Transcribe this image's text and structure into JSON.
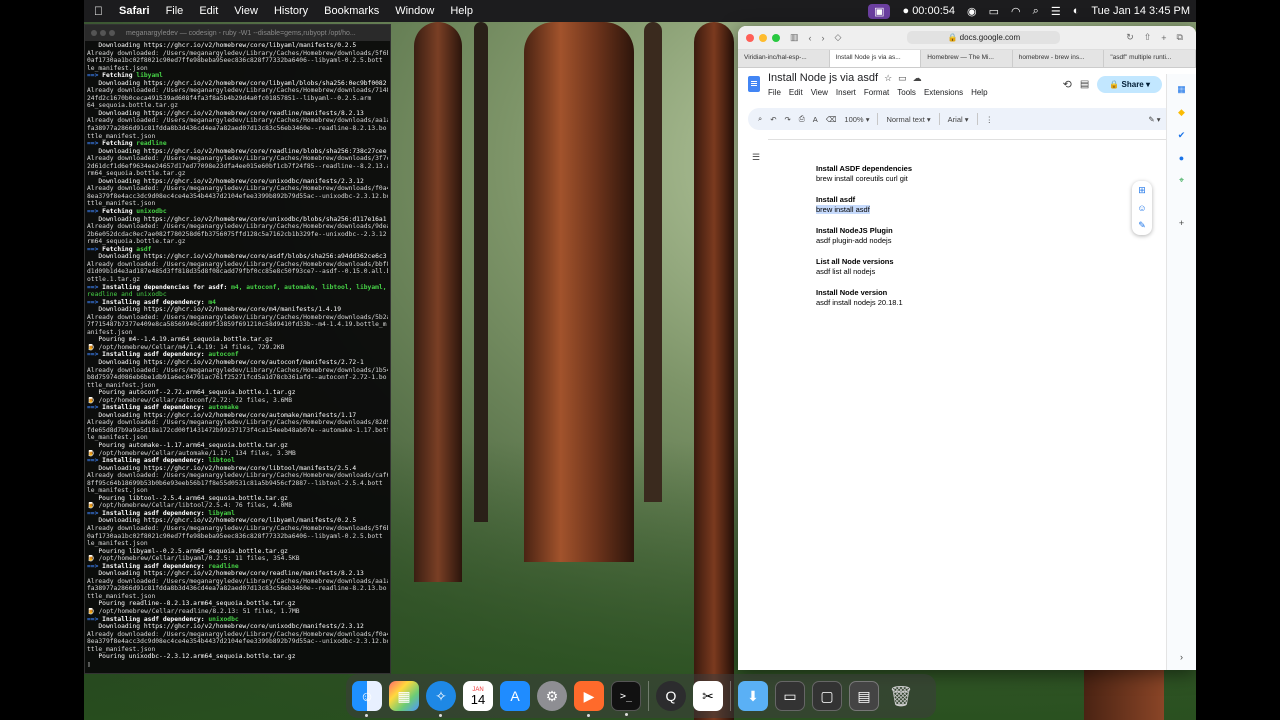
{
  "menubar": {
    "app": "Safari",
    "items": [
      "File",
      "Edit",
      "View",
      "History",
      "Bookmarks",
      "Window",
      "Help"
    ],
    "timer": "00:00:54",
    "datetime": "Tue Jan 14  3:45 PM"
  },
  "terminal": {
    "title": "meganargyledev — codesign - ruby -W1 --disable=gems,rubyopt /opt/ho...",
    "lines": [
      {
        "t": "dl",
        "s": "   Downloading https://ghcr.io/v2/homebrew/core/libyaml/manifests/0.2.5"
      },
      {
        "t": "",
        "s": "Already downloaded: /Users/meganargyledev/Library/Caches/Homebrew/downloads/5f6b"
      },
      {
        "t": "",
        "s": "0af1730aa1bc02f8021c90ed7ffe98beba95eec836c828f77332ba6406--libyaml-0.2.5.bott"
      },
      {
        "t": "",
        "s": "le_manifest.json"
      },
      {
        "t": "arrow",
        "s": "Fetching ",
        "g": "libyaml"
      },
      {
        "t": "dl",
        "s": "   Downloading https://ghcr.io/v2/homebrew/core/libyaml/blobs/sha256:0ec9bf0082"
      },
      {
        "t": "",
        "s": "Already downloaded: /Users/meganargyledev/Library/Caches/Homebrew/downloads/7148"
      },
      {
        "t": "",
        "s": "24fd2c1670b0ceca491539ad608f4fa3f8a5b4b29d4a0fc01857851--libyaml--0.2.5.arm"
      },
      {
        "t": "",
        "s": "64_sequoia.bottle.tar.gz"
      },
      {
        "t": "dl",
        "s": "   Downloading https://ghcr.io/v2/homebrew/core/readline/manifests/8.2.13"
      },
      {
        "t": "",
        "s": "Already downloaded: /Users/meganargyledev/Library/Caches/Homebrew/downloads/aa1a"
      },
      {
        "t": "",
        "s": "fa38977a2866d91c81fdda8b3d436cd4ea7a82aed07d13c83c56eb3460e--readline-8.2.13.bo"
      },
      {
        "t": "",
        "s": "ttle_manifest.json"
      },
      {
        "t": "arrow",
        "s": "Fetching ",
        "g": "readline"
      },
      {
        "t": "dl",
        "s": "   Downloading https://ghcr.io/v2/homebrew/core/readline/blobs/sha256:738c27cee"
      },
      {
        "t": "",
        "s": "Already downloaded: /Users/meganargyledev/Library/Caches/Homebrew/downloads/3f7c"
      },
      {
        "t": "",
        "s": "2d61dcf1d6ef9634ee24657d17ed77098e23dfa4ee015e60bf1cb7f24f85--readline--8.2.13.a"
      },
      {
        "t": "",
        "s": "rm64_sequoia.bottle.tar.gz"
      },
      {
        "t": "dl",
        "s": "   Downloading https://ghcr.io/v2/homebrew/core/unixodbc/manifests/2.3.12"
      },
      {
        "t": "",
        "s": "Already downloaded: /Users/meganargyledev/Library/Caches/Homebrew/downloads/f0a4"
      },
      {
        "t": "",
        "s": "8ea379f8e4acc3dc9d08ec4ce4e354b4437d2104efee3399b892b79d55ac--unixodbc-2.3.12.bo"
      },
      {
        "t": "",
        "s": "ttle_manifest.json"
      },
      {
        "t": "arrow",
        "s": "Fetching ",
        "g": "unixodbc"
      },
      {
        "t": "dl",
        "s": "   Downloading https://ghcr.io/v2/homebrew/core/unixodbc/blobs/sha256:d117e16a1"
      },
      {
        "t": "",
        "s": "Already downloaded: /Users/meganargyledev/Library/Caches/Homebrew/downloads/9dea"
      },
      {
        "t": "",
        "s": "2b6e052dcdac0ec7ae082f780258d6fb3756075ffd128c5a7162cb1b329fe--unixodbc--2.3.12.a"
      },
      {
        "t": "",
        "s": "rm64_sequoia.bottle.tar.gz"
      },
      {
        "t": "arrow",
        "s": "Fetching ",
        "g": "asdf"
      },
      {
        "t": "dl",
        "s": "   Downloading https://ghcr.io/v2/homebrew/core/asdf/blobs/sha256:a94dd362ce6c3"
      },
      {
        "t": "",
        "s": "Already downloaded: /Users/meganargyledev/Library/Caches/Homebrew/downloads/bbf8"
      },
      {
        "t": "",
        "s": "d1d09b1d4e3ad187e485d3ff818d35d8f08cadd79fbf0cc85e8c50f93ce7--asdf--0.15.0.all.b"
      },
      {
        "t": "",
        "s": "ottle.1.tar.gz"
      },
      {
        "t": "arrow",
        "s": "Installing dependencies for asdf: ",
        "g": "m4, autoconf, automake, libtool, libyaml,"
      },
      {
        "t": "g",
        "s": "",
        "g": "readline and unixodbc"
      },
      {
        "t": "arrow",
        "s": "Installing asdf dependency: ",
        "g": "m4"
      },
      {
        "t": "dl",
        "s": "   Downloading https://ghcr.io/v2/homebrew/core/m4/manifests/1.4.19"
      },
      {
        "t": "",
        "s": "Already downloaded: /Users/meganargyledev/Library/Caches/Homebrew/downloads/5b2a"
      },
      {
        "t": "",
        "s": "7f715487b7377e409e8ca58569940cd89f33859f691210c58d9410fd33b--m4-1.4.19.bottle_m"
      },
      {
        "t": "",
        "s": "anifest.json"
      },
      {
        "t": "dl",
        "s": "   Pouring m4--1.4.19.arm64_sequoia.bottle.tar.gz"
      },
      {
        "t": "beer",
        "s": "/opt/homebrew/Cellar/m4/1.4.19: 14 files, 729.2KB"
      },
      {
        "t": "arrow",
        "s": "Installing asdf dependency: ",
        "g": "autoconf"
      },
      {
        "t": "dl",
        "s": "   Downloading https://ghcr.io/v2/homebrew/core/autoconf/manifests/2.72-1"
      },
      {
        "t": "",
        "s": "Already downloaded: /Users/meganargyledev/Library/Caches/Homebrew/downloads/1b54"
      },
      {
        "t": "",
        "s": "b8d75974d086eb6be1db91a6ec04791ac761f25271fcd5a1d78cb361afd--autoconf-2.72-1.bo"
      },
      {
        "t": "",
        "s": "ttle_manifest.json"
      },
      {
        "t": "dl",
        "s": "   Pouring autoconf--2.72.arm64_sequoia.bottle.1.tar.gz"
      },
      {
        "t": "beer",
        "s": "/opt/homebrew/Cellar/autoconf/2.72: 72 files, 3.6MB"
      },
      {
        "t": "arrow",
        "s": "Installing asdf dependency: ",
        "g": "automake"
      },
      {
        "t": "dl",
        "s": "   Downloading https://ghcr.io/v2/homebrew/core/automake/manifests/1.17"
      },
      {
        "t": "",
        "s": "Already downloaded: /Users/meganargyledev/Library/Caches/Homebrew/downloads/82d9"
      },
      {
        "t": "",
        "s": "fde65d8d7b9a9a5d18a172cd00f1431472b99237173f4ca154eeb48ab07e--automake-1.17.bott"
      },
      {
        "t": "",
        "s": "le_manifest.json"
      },
      {
        "t": "dl",
        "s": "   Pouring automake--1.17.arm64_sequoia.bottle.tar.gz"
      },
      {
        "t": "beer",
        "s": "/opt/homebrew/Cellar/automake/1.17: 134 files, 3.3MB"
      },
      {
        "t": "arrow",
        "s": "Installing asdf dependency: ",
        "g": "libtool"
      },
      {
        "t": "dl",
        "s": "   Downloading https://ghcr.io/v2/homebrew/core/libtool/manifests/2.5.4"
      },
      {
        "t": "",
        "s": "Already downloaded: /Users/meganargyledev/Library/Caches/Homebrew/downloads/caf6"
      },
      {
        "t": "",
        "s": "8ff95c64b18699b53b0b6e93eeb56b17f8e55d0531c81a5b9456cf2887--libtool-2.5.4.bott"
      },
      {
        "t": "",
        "s": "le_manifest.json"
      },
      {
        "t": "dl",
        "s": "   Pouring libtool--2.5.4.arm64_sequoia.bottle.tar.gz"
      },
      {
        "t": "beer",
        "s": "/opt/homebrew/Cellar/libtool/2.5.4: 76 files, 4.0MB"
      },
      {
        "t": "arrow",
        "s": "Installing asdf dependency: ",
        "g": "libyaml"
      },
      {
        "t": "dl",
        "s": "   Downloading https://ghcr.io/v2/homebrew/core/libyaml/manifests/0.2.5"
      },
      {
        "t": "",
        "s": "Already downloaded: /Users/meganargyledev/Library/Caches/Homebrew/downloads/5f6b"
      },
      {
        "t": "",
        "s": "0af1730aa1bc02f8021c90ed7ffe98beba95eec836c828f77332ba6406--libyaml-0.2.5.bott"
      },
      {
        "t": "",
        "s": "le_manifest.json"
      },
      {
        "t": "dl",
        "s": "   Pouring libyaml--0.2.5.arm64_sequoia.bottle.tar.gz"
      },
      {
        "t": "beer",
        "s": "/opt/homebrew/Cellar/libyaml/0.2.5: 11 files, 354.5KB"
      },
      {
        "t": "arrow",
        "s": "Installing asdf dependency: ",
        "g": "readline"
      },
      {
        "t": "dl",
        "s": "   Downloading https://ghcr.io/v2/homebrew/core/readline/manifests/8.2.13"
      },
      {
        "t": "",
        "s": "Already downloaded: /Users/meganargyledev/Library/Caches/Homebrew/downloads/aa1a"
      },
      {
        "t": "",
        "s": "fa38977a2866d91c81fdda8b3d436cd4ea7a82aed07d13c83c56eb3460e--readline-8.2.13.bo"
      },
      {
        "t": "",
        "s": "ttle_manifest.json"
      },
      {
        "t": "dl",
        "s": "   Pouring readline--8.2.13.arm64_sequoia.bottle.tar.gz"
      },
      {
        "t": "beer",
        "s": "/opt/homebrew/Cellar/readline/8.2.13: 51 files, 1.7MB"
      },
      {
        "t": "arrow",
        "s": "Installing asdf dependency: ",
        "g": "unixodbc"
      },
      {
        "t": "dl",
        "s": "   Downloading https://ghcr.io/v2/homebrew/core/unixodbc/manifests/2.3.12"
      },
      {
        "t": "",
        "s": "Already downloaded: /Users/meganargyledev/Library/Caches/Homebrew/downloads/f0a4"
      },
      {
        "t": "",
        "s": "8ea379f8e4acc3dc9d08ec4ce4e354b4437d2104efee3399b892b79d55ac--unixodbc-2.3.12.bo"
      },
      {
        "t": "",
        "s": "ttle_manifest.json"
      },
      {
        "t": "dl",
        "s": "   Pouring unixodbc--2.3.12.arm64_sequoia.bottle.tar.gz"
      }
    ]
  },
  "browser": {
    "url": "docs.google.com",
    "tabs": [
      "Viridian-inc/hal-esp-...",
      "Install Node js via as...",
      "Homebrew — The Mi...",
      "homebrew - brew ins...",
      "\"asdf\" multiple runti..."
    ],
    "active_tab": 1
  },
  "docs": {
    "title": "Install Node js via asdf",
    "menu": [
      "File",
      "Edit",
      "View",
      "Insert",
      "Format",
      "Tools",
      "Extensions",
      "Help"
    ],
    "share_label": "Share",
    "avatar_letter": "M",
    "zoom": "100%",
    "style": "Normal text",
    "font": "Arial",
    "sections": [
      {
        "heading": "Install ASDF dependencies",
        "body": "brew install coreutils curl git",
        "selected": false
      },
      {
        "heading": "Install asdf",
        "body": "brew install asdf",
        "selected": true
      },
      {
        "heading": "Install NodeJS Plugin",
        "body": "asdf plugin-add nodejs",
        "selected": false
      },
      {
        "heading": "List all Node versions",
        "body": "asdf list all nodejs",
        "selected": false
      },
      {
        "heading": "Install Node version",
        "body": "asdf install nodejs 20.18.1",
        "selected": false
      }
    ]
  },
  "dock": {
    "calendar_month": "JAN",
    "calendar_day": "14",
    "apps": [
      "finder-icon",
      "launchpad-icon",
      "safari-icon",
      "calendar-icon",
      "app-store-icon",
      "system-settings-icon",
      "screen-recorder-icon",
      "terminal-icon",
      "quicktime-icon",
      "capcut-icon",
      "downloads-folder-icon",
      "screenshot-icon",
      "window-icon",
      "app-switcher-icon",
      "trash-icon"
    ]
  },
  "colors": {
    "terminal_arrow": "#3a7be8",
    "terminal_green": "#46d146",
    "docs_share": "#c2e7ff",
    "docs_selection": "#c6dafc"
  }
}
